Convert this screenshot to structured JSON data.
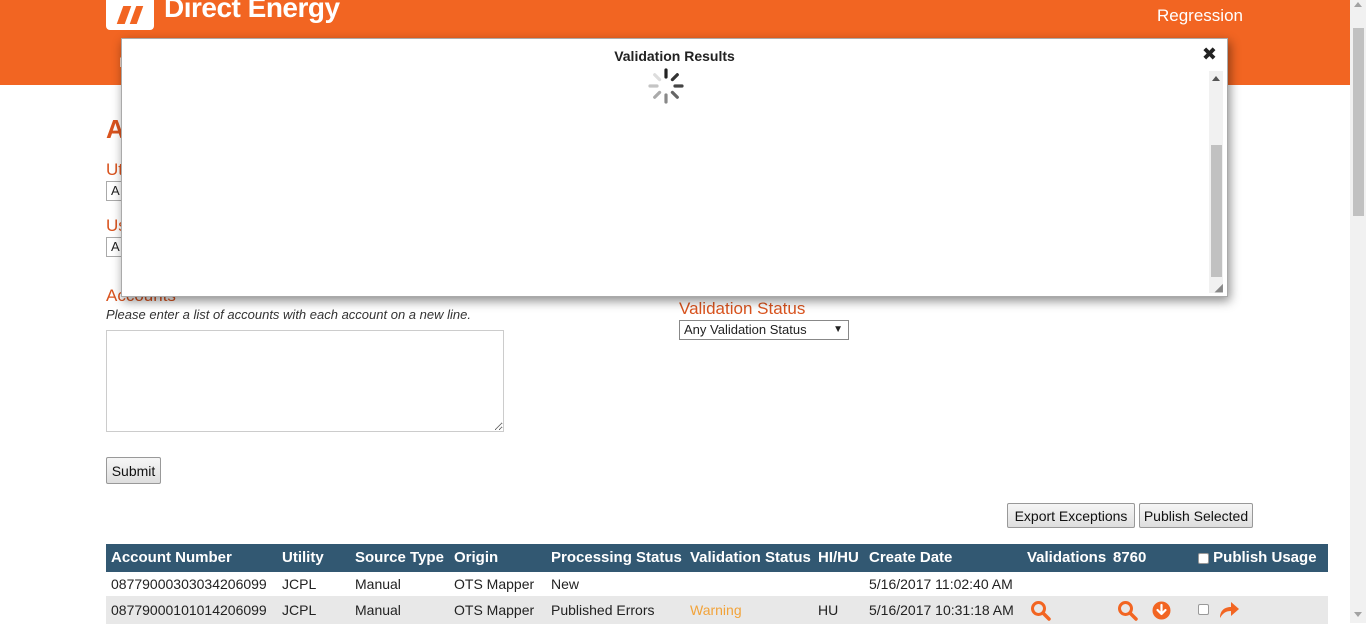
{
  "header": {
    "brand": "Direct Energy",
    "environment": "Regression",
    "nav_stub": "I"
  },
  "page": {
    "title_stub": "A",
    "utility_label_stub": "Ut",
    "utility_value_stub": "A",
    "usage_label_stub": "Us",
    "usage_value_stub": "A"
  },
  "form": {
    "accounts_label": "Accounts",
    "accounts_help": "Please enter a list of accounts with each account on a new line.",
    "accounts_value": "",
    "validation_status_label": "Validation Status",
    "validation_status_value": "Any Validation Status",
    "submit_label": "Submit"
  },
  "actions": {
    "export_label": "Export Exceptions",
    "publish_label": "Publish Selected"
  },
  "table": {
    "columns": [
      "Account Number",
      "Utility",
      "Source Type",
      "Origin",
      "Processing Status",
      "Validation Status",
      "HI/HU",
      "Create Date",
      "Validations",
      "8760",
      "Publish Usage"
    ],
    "rows": [
      {
        "account": "08779000303034206099",
        "utility": "JCPL",
        "source": "Manual",
        "origin": "OTS Mapper",
        "processing": "New",
        "validation": "",
        "hihu": "",
        "created": "5/16/2017 11:02:40 AM"
      },
      {
        "account": "08779000101014206099",
        "utility": "JCPL",
        "source": "Manual",
        "origin": "OTS Mapper",
        "processing": "Published Errors",
        "validation": "Warning",
        "hihu": "HU",
        "created": "5/16/2017 10:31:18 AM"
      }
    ]
  },
  "modal": {
    "title": "Validation Results",
    "close_glyph": "✖",
    "grip": "◢"
  },
  "colors": {
    "brand_orange": "#f26522",
    "header_navy": "#325872",
    "warning": "#f2a33a"
  }
}
